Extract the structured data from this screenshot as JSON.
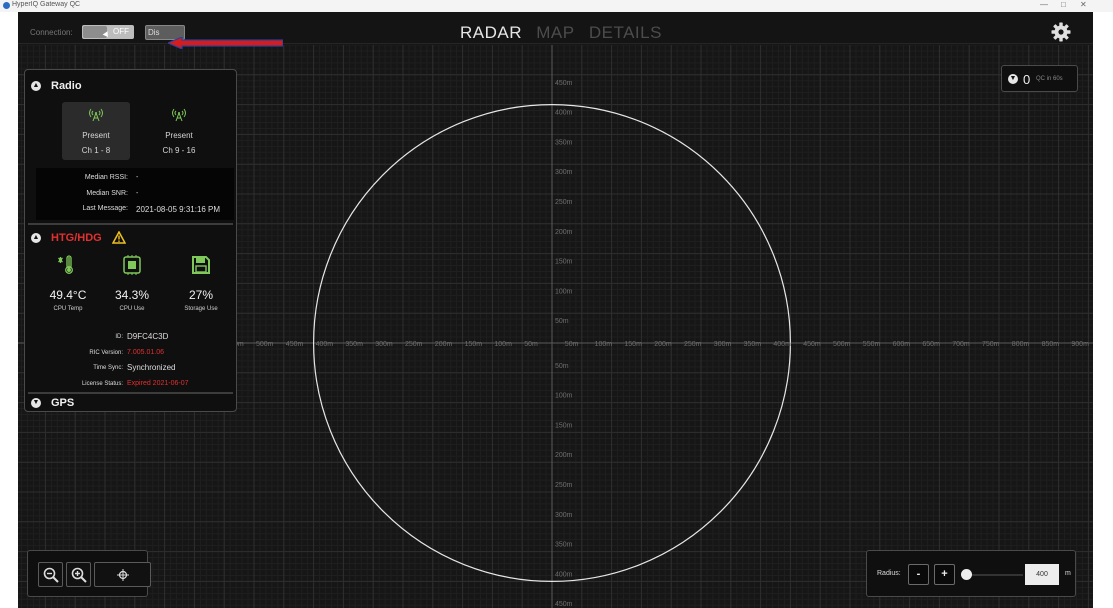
{
  "window": {
    "title": "HyperIQ Gateway QC"
  },
  "connection": {
    "label": "Connection:",
    "toggle": "OFF",
    "display_btn": "Dis"
  },
  "tabs": [
    {
      "label": "RADAR",
      "active": true
    },
    {
      "label": "MAP",
      "active": false
    },
    {
      "label": "DETAILS",
      "active": false
    }
  ],
  "radar": {
    "radius_m": 400,
    "x_left_labels": [
      "550m",
      "500m",
      "450m",
      "400m",
      "350m",
      "300m",
      "250m",
      "200m",
      "150m",
      "100m",
      "50m"
    ],
    "x_right_labels": [
      "50m",
      "100m",
      "150m",
      "200m",
      "250m",
      "300m",
      "350m",
      "400m",
      "450m",
      "500m",
      "550m",
      "600m",
      "650m",
      "700m",
      "750m",
      "800m",
      "850m",
      "900m"
    ],
    "y_top_labels": [
      "450m",
      "400m",
      "350m",
      "300m",
      "250m",
      "200m",
      "150m",
      "100m",
      "50m"
    ],
    "y_bottom_labels": [
      "50m",
      "100m",
      "150m",
      "200m",
      "250m",
      "300m",
      "350m",
      "400m",
      "450m"
    ]
  },
  "radio": {
    "title": "Radio",
    "cards": [
      {
        "status": "Present",
        "channels": "Ch 1 - 8",
        "selected": true
      },
      {
        "status": "Present",
        "channels": "Ch 9 - 16",
        "selected": false
      }
    ],
    "median_rssi_label": "Median RSSI:",
    "median_rssi": "-",
    "median_snr_label": "Median SNR:",
    "median_snr": "-",
    "last_message_label": "Last Message:",
    "last_message": "2021-08-05 9:31:16 PM"
  },
  "htg": {
    "title": "HTG/HDG",
    "cpu_temp": "49.4°C",
    "cpu_temp_label": "CPU Temp",
    "cpu_use": "34.3%",
    "cpu_use_label": "CPU Use",
    "storage_use": "27%",
    "storage_use_label": "Storage Use",
    "id_label": "ID:",
    "id": "D9FC4C3D",
    "ric_label": "RIC Version:",
    "ric": "7.005.01.06",
    "time_sync_label": "Time Sync:",
    "time_sync": "Synchronized",
    "license_label": "License Status:",
    "license": "Expired 2021-06-07"
  },
  "gps": {
    "title": "GPS"
  },
  "counter": {
    "value": "0",
    "label": "QC in 60s"
  },
  "radius_control": {
    "label": "Radius:",
    "minus": "-",
    "plus": "+",
    "value": "400",
    "unit": "m",
    "slider_level": 0.1
  },
  "colors": {
    "accent_red": "#e23030",
    "warning": "#f0c020",
    "icon_green": "#7fc85a",
    "background": "#161616"
  }
}
